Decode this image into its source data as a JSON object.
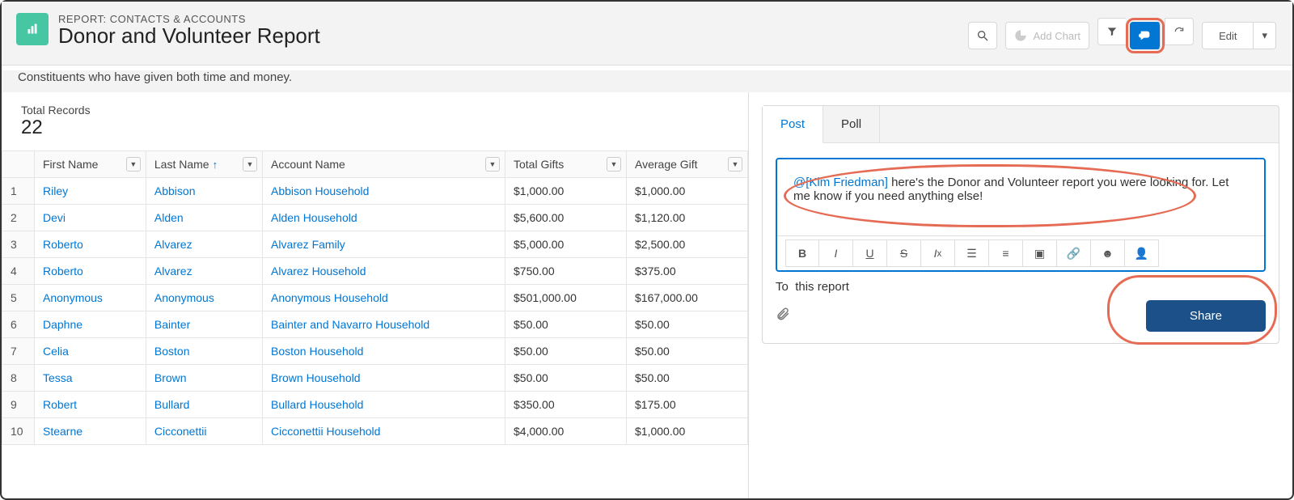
{
  "header": {
    "eyebrow": "REPORT: CONTACTS & ACCOUNTS",
    "title": "Donor and Volunteer Report",
    "subtitle": "Constituents who have given both time and money.",
    "addChartLabel": "Add Chart",
    "editLabel": "Edit"
  },
  "summary": {
    "label": "Total Records",
    "value": "22"
  },
  "columns": {
    "firstName": "First Name",
    "lastName": "Last Name",
    "accountName": "Account Name",
    "totalGifts": "Total Gifts",
    "averageGift": "Average Gift"
  },
  "rows": [
    {
      "idx": "1",
      "first": "Riley",
      "last": "Abbison",
      "account": "Abbison Household",
      "total": "$1,000.00",
      "avg": "$1,000.00"
    },
    {
      "idx": "2",
      "first": "Devi",
      "last": "Alden",
      "account": "Alden Household",
      "total": "$5,600.00",
      "avg": "$1,120.00"
    },
    {
      "idx": "3",
      "first": "Roberto",
      "last": "Alvarez",
      "account": "Alvarez Family",
      "total": "$5,000.00",
      "avg": "$2,500.00"
    },
    {
      "idx": "4",
      "first": "Roberto",
      "last": "Alvarez",
      "account": "Alvarez Household",
      "total": "$750.00",
      "avg": "$375.00"
    },
    {
      "idx": "5",
      "first": "Anonymous",
      "last": "Anonymous",
      "account": "Anonymous Household",
      "total": "$501,000.00",
      "avg": "$167,000.00"
    },
    {
      "idx": "6",
      "first": "Daphne",
      "last": "Bainter",
      "account": "Bainter and Navarro Household",
      "total": "$50.00",
      "avg": "$50.00"
    },
    {
      "idx": "7",
      "first": "Celia",
      "last": "Boston",
      "account": "Boston Household",
      "total": "$50.00",
      "avg": "$50.00"
    },
    {
      "idx": "8",
      "first": "Tessa",
      "last": "Brown",
      "account": "Brown Household",
      "total": "$50.00",
      "avg": "$50.00"
    },
    {
      "idx": "9",
      "first": "Robert",
      "last": "Bullard",
      "account": "Bullard Household",
      "total": "$350.00",
      "avg": "$175.00"
    },
    {
      "idx": "10",
      "first": "Stearne",
      "last": "Cicconettii",
      "account": "Cicconettii Household",
      "total": "$4,000.00",
      "avg": "$1,000.00"
    }
  ],
  "feed": {
    "tabs": {
      "post": "Post",
      "poll": "Poll"
    },
    "mention": "@[Kim Friedman]",
    "message": " here's the Donor and Volunteer   report you were looking for. Let me know if you need anything else!",
    "toLabel": "To",
    "toValue": "this report",
    "shareLabel": "Share"
  }
}
